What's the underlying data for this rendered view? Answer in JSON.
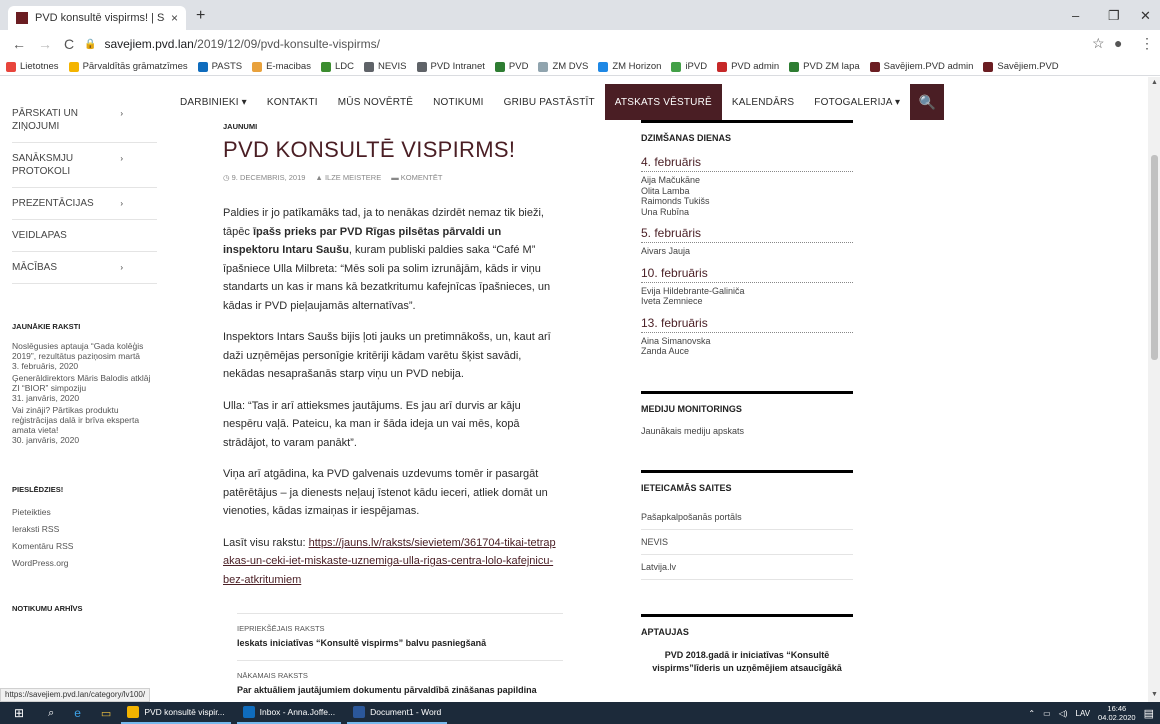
{
  "browser": {
    "tab_title": "PVD konsultē vispirms! | Savējiem",
    "tab_close": "×",
    "new_tab": "+",
    "url_host": "savejiem.pvd.lan",
    "url_path": "/2019/12/09/pvd-konsulte-vispirms/",
    "bookmarks": [
      {
        "label": "Lietotnes",
        "color": "#e8453c"
      },
      {
        "label": "Pārvaldītās grāmatzīmes",
        "color": "#f4b400"
      },
      {
        "label": "PASTS",
        "color": "#0f6cbd"
      },
      {
        "label": "E-macibas",
        "color": "#e8a13c"
      },
      {
        "label": "LDC",
        "color": "#3c8d2f"
      },
      {
        "label": "NEVIS",
        "color": "#5f6368"
      },
      {
        "label": "PVD Intranet",
        "color": "#5f6368"
      },
      {
        "label": "PVD",
        "color": "#2e7d32"
      },
      {
        "label": "ZM DVS",
        "color": "#90a4ae"
      },
      {
        "label": "ZM Horizon",
        "color": "#1e88e5"
      },
      {
        "label": "iPVD",
        "color": "#43a047"
      },
      {
        "label": "PVD admin",
        "color": "#c62828"
      },
      {
        "label": "PVD ZM lapa",
        "color": "#2e7d32"
      },
      {
        "label": "Savējiem.PVD admin",
        "color": "#6b1d22"
      },
      {
        "label": "Savējiem.PVD",
        "color": "#6b1d22"
      }
    ]
  },
  "nav": {
    "items": [
      "DARBINIEKI ▾",
      "KONTAKTI",
      "MŪS NOVĒRTĒ",
      "NOTIKUMI",
      "GRIBU PASTĀSTĪT",
      "ATSKATS VĒSTURĒ",
      "KALENDĀRS",
      "FOTOGALERIJA ▾"
    ],
    "search_icon": "🔍"
  },
  "left_menu": [
    {
      "label": "PĀRSKATI UN ZIŅOJUMI",
      "arrow": "›"
    },
    {
      "label": "SANĀKSMJU PROTOKOLI",
      "arrow": "›"
    },
    {
      "label": "PREZENTĀCIJAS",
      "arrow": "›"
    },
    {
      "label": "VEIDLAPAS",
      "arrow": ""
    },
    {
      "label": "MĀCĪBAS",
      "arrow": "›"
    }
  ],
  "recent": {
    "heading": "JAUNĀKIE RAKSTI",
    "items": [
      {
        "title": "Noslēgusies aptauja “Gada kolēģis 2019”, rezultātus paziņosim martā",
        "date": "3. februāris, 2020"
      },
      {
        "title": "Ģenerāldirektors Māris Balodis atklāj ZI “BIOR” simpoziju",
        "date": "31. janvāris, 2020"
      },
      {
        "title": "Vai zināji? Pārtikas produktu reģistrācijas dalā ir brīva eksperta amata vieta!",
        "date": "30. janvāris, 2020"
      }
    ]
  },
  "meta": {
    "heading": "PIESLĒDZIES!",
    "items": [
      "Pieteikties",
      "Ieraksti RSS",
      "Komentāru RSS",
      "WordPress.org"
    ]
  },
  "archive_heading": "NOTIKUMU ARHĪVS",
  "article": {
    "category": "JAUNUMI",
    "title": "PVD KONSULTĒ VISPIRMS!",
    "date": "9. DECEMBRIS, 2019",
    "author": "ILZE MEISTERE",
    "comment": "KOMENTĒT",
    "p1_a": "Paldies  ir  jo patīkamāks tad, ja to nenākas dzirdēt nemaz tik bieži, tāpēc ",
    "p1_b": "īpašs prieks par PVD Rīgas pilsētas pārvaldi un inspektoru Intaru Saušu",
    "p1_c": ", kuram publiski paldies saka “Café M” īpašniece Ulla Milbreta: “Mēs soli pa solim izrunājām, kāds ir viņu standarts un kas ir mans kā bezatkritumu kafejnīcas īpašnieces, un kādas ir PVD pieļaujamās alternatīvas”.",
    "p2": "Inspektors Intars Saušs bijis ļoti jauks un pretimnākošs, un, kaut arī daži uzņēmējas personīgie kritēriji kādam varētu šķist savādi, nekādas nesaprašanās starp viņu un PVD nebija.",
    "p3": "Ulla:  “Tas ir arī attieksmes jautājums. Es jau arī durvis ar kāju nespēru vaļā. Pateicu, ka man ir šāda ideja un vai mēs, kopā strādājot, to varam panākt”.",
    "p4": "Viņa arī atgādina, ka PVD galvenais uzdevums tomēr ir pasargāt patērētājus – ja dienests neļauj īstenot kādu ieceri, atliek domāt un vienoties, kādas izmaiņas ir iespējamas.",
    "p5_label": "Lasīt visu rakstu: ",
    "p5_link": "https://jauns.lv/raksts/sievietem/361704-tikai-tetrapakas-un-ceki-iet-miskaste-uznemiga-ulla-rigas-centra-lolo-kafejnicu-bez-atkritumiem",
    "prev_label": "IEPRIEKŠĒJAIS RAKSTS",
    "prev_title": "Ieskats iniciatīvas “Konsultē vispirms” balvu pasniegšanā",
    "next_label": "NĀKAMAIS RAKSTS",
    "next_title": "Par aktuāliem jautājumiem dokumentu pārvaldībā zināšanas papildina"
  },
  "birthdays": {
    "heading": "DZIMŠANAS DIENAS",
    "groups": [
      {
        "date": "4. februāris",
        "names": [
          "Aija Mačukāne",
          "Olita Lamba",
          "Raimonds Tukišs",
          "Una Rubīna"
        ]
      },
      {
        "date": "5. februāris",
        "names": [
          "Aivars Jauja"
        ]
      },
      {
        "date": "10. februāris",
        "names": [
          "Evija Hildebrante-Galiniča",
          "Iveta Zemniece"
        ]
      },
      {
        "date": "13. februāris",
        "names": [
          "Aina Simanovska",
          "Zanda Auce"
        ]
      }
    ]
  },
  "media": {
    "heading": "MEDIJU MONITORINGS",
    "link": "Jaunākais mediju apskats"
  },
  "links": {
    "heading": "IETEICAMĀS SAITES",
    "items": [
      "Pašapkalpošanās portāls",
      "NEVIS",
      "Latvija.lv"
    ]
  },
  "polls": {
    "heading": "APTAUJAS",
    "text": "PVD 2018.gadā ir iniciatīvas “Konsultē vispirms”līderis un uzņēmējiem atsaucīgākā"
  },
  "status_url": "https://savejiem.pvd.lan/category/lv100/",
  "taskbar": {
    "items": [
      {
        "label": "PVD konsultē vispir...",
        "color": "#f4b400"
      },
      {
        "label": "Inbox - Anna.Joffe...",
        "color": "#0f6cbd"
      },
      {
        "label": "Document1 - Word",
        "color": "#2b579a"
      }
    ],
    "lang": "LAV",
    "time": "16:46",
    "date": "04.02.2020"
  }
}
